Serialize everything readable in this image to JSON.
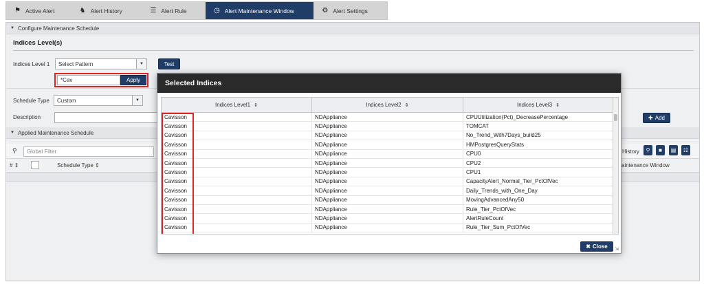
{
  "tabs": [
    {
      "label": "Active Alert",
      "icon": "alarm-light-icon"
    },
    {
      "label": "Alert History",
      "icon": "bell-icon"
    },
    {
      "label": "Alert Rule",
      "icon": "rule-list-icon"
    },
    {
      "label": "Alert Maintenance Window",
      "icon": "clock-icon"
    },
    {
      "label": "Alert Settings",
      "icon": "gear-icon"
    }
  ],
  "configure": {
    "header": "Configure Maintenance Schedule",
    "indices_title": "Indices Level(s)",
    "indices_level1_label": "Indices Level 1",
    "select_pattern": "Select Pattern",
    "test_label": "Test",
    "pattern_value": "*Cav",
    "apply_label": "Apply",
    "schedule_type_label": "Schedule Type",
    "schedule_type_value": "Custom",
    "description_label": "Description",
    "add_label": "Add"
  },
  "applied": {
    "header": "Applied Maintenance Schedule",
    "filter_placeholder": "Global Filter",
    "history_label": "History",
    "col_num": "#",
    "col_schedule_type": "Schedule Type",
    "col_maintenance_window": "aintenance Window"
  },
  "modal": {
    "title": "Selected Indices",
    "columns": [
      "Indices Level1",
      "Indices Level2",
      "Indices Level3"
    ],
    "rows": [
      [
        "Cavisson",
        "NDAppliance",
        "CPUUtilization(Pct)_DecreasePercentage"
      ],
      [
        "Cavisson",
        "NDAppliance",
        "TOMCAT"
      ],
      [
        "Cavisson",
        "NDAppliance",
        "No_Trend_With7Days_build25"
      ],
      [
        "Cavisson",
        "NDAppliance",
        "HMPostgresQueryStats"
      ],
      [
        "Cavisson",
        "NDAppliance",
        "CPU0"
      ],
      [
        "Cavisson",
        "NDAppliance",
        "CPU2"
      ],
      [
        "Cavisson",
        "NDAppliance",
        "CPU1"
      ],
      [
        "Cavisson",
        "NDAppliance",
        "CapacityAlert_Normal_Tier_PctOfVec"
      ],
      [
        "Cavisson",
        "NDAppliance",
        "Daily_Trends_with_One_Day"
      ],
      [
        "Cavisson",
        "NDAppliance",
        "MovingAdvancedAny50"
      ],
      [
        "Cavisson",
        "NDAppliance",
        "Rule_Tier_PctOfVec"
      ],
      [
        "Cavisson",
        "NDAppliance",
        "AlertRuleCount"
      ],
      [
        "Cavisson",
        "NDAppliance",
        "Rule_Tier_Sum_PctOfVec"
      ]
    ],
    "close_label": "Close"
  },
  "colors": {
    "accent": "#1f3d66",
    "highlight": "#e02424",
    "modal_title_bg": "#2a2a2a"
  }
}
